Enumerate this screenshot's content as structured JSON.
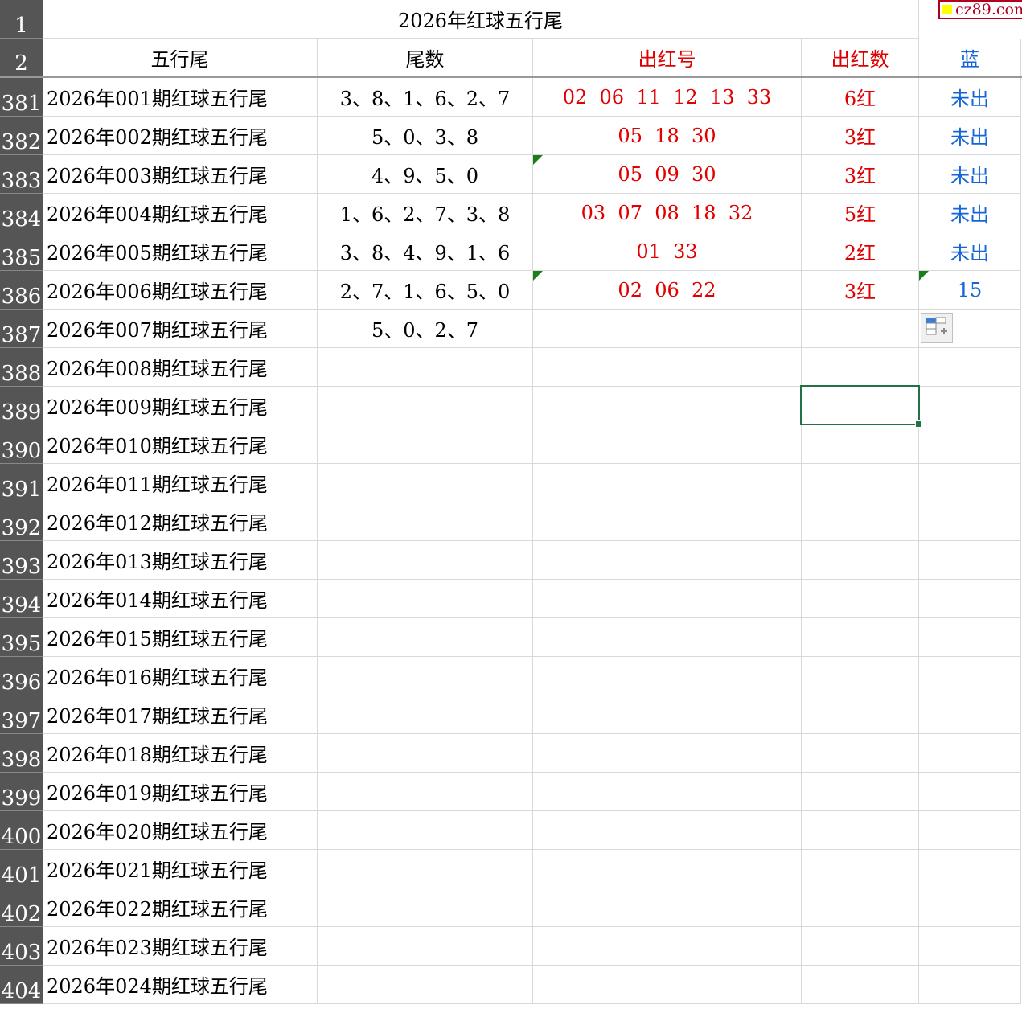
{
  "title": "2026年红球五行尾",
  "watermark": "cz89.com",
  "headers": {
    "row_num": "2",
    "a": "五行尾",
    "b": "尾数",
    "c": "出红号",
    "d": "出红数",
    "e": "蓝"
  },
  "title_row_num": "1",
  "rows": [
    {
      "n": "381",
      "a": "2026年001期红球五行尾",
      "b": "3、8、1、6、2、7",
      "c": "02  06  11  12  13  33",
      "d": "6红",
      "e": "未出"
    },
    {
      "n": "382",
      "a": "2026年002期红球五行尾",
      "b": "5、0、3、8",
      "c": "05  18  30",
      "d": "3红",
      "e": "未出"
    },
    {
      "n": "383",
      "a": "2026年003期红球五行尾",
      "b": "4、9、5、0",
      "c": "05  09  30",
      "d": "3红",
      "e": "未出"
    },
    {
      "n": "384",
      "a": "2026年004期红球五行尾",
      "b": "1、6、2、7、3、8",
      "c": "03  07  08  18  32",
      "d": "5红",
      "e": "未出"
    },
    {
      "n": "385",
      "a": "2026年005期红球五行尾",
      "b": "3、8、4、9、1、6",
      "c": "01  33",
      "d": "2红",
      "e": "未出"
    },
    {
      "n": "386",
      "a": "2026年006期红球五行尾",
      "b": "2、7、1、6、5、0",
      "c": "02  06  22",
      "d": "3红",
      "e": "15"
    },
    {
      "n": "387",
      "a": "2026年007期红球五行尾",
      "b": "5、0、2、7",
      "c": "",
      "d": "",
      "e": ""
    },
    {
      "n": "388",
      "a": "2026年008期红球五行尾",
      "b": "",
      "c": "",
      "d": "",
      "e": ""
    },
    {
      "n": "389",
      "a": "2026年009期红球五行尾",
      "b": "",
      "c": "",
      "d": "",
      "e": ""
    },
    {
      "n": "390",
      "a": "2026年010期红球五行尾",
      "b": "",
      "c": "",
      "d": "",
      "e": ""
    },
    {
      "n": "391",
      "a": "2026年011期红球五行尾",
      "b": "",
      "c": "",
      "d": "",
      "e": ""
    },
    {
      "n": "392",
      "a": "2026年012期红球五行尾",
      "b": "",
      "c": "",
      "d": "",
      "e": ""
    },
    {
      "n": "393",
      "a": "2026年013期红球五行尾",
      "b": "",
      "c": "",
      "d": "",
      "e": ""
    },
    {
      "n": "394",
      "a": "2026年014期红球五行尾",
      "b": "",
      "c": "",
      "d": "",
      "e": ""
    },
    {
      "n": "395",
      "a": "2026年015期红球五行尾",
      "b": "",
      "c": "",
      "d": "",
      "e": ""
    },
    {
      "n": "396",
      "a": "2026年016期红球五行尾",
      "b": "",
      "c": "",
      "d": "",
      "e": ""
    },
    {
      "n": "397",
      "a": "2026年017期红球五行尾",
      "b": "",
      "c": "",
      "d": "",
      "e": ""
    },
    {
      "n": "398",
      "a": "2026年018期红球五行尾",
      "b": "",
      "c": "",
      "d": "",
      "e": ""
    },
    {
      "n": "399",
      "a": "2026年019期红球五行尾",
      "b": "",
      "c": "",
      "d": "",
      "e": ""
    },
    {
      "n": "400",
      "a": "2026年020期红球五行尾",
      "b": "",
      "c": "",
      "d": "",
      "e": ""
    },
    {
      "n": "401",
      "a": "2026年021期红球五行尾",
      "b": "",
      "c": "",
      "d": "",
      "e": ""
    },
    {
      "n": "402",
      "a": "2026年022期红球五行尾",
      "b": "",
      "c": "",
      "d": "",
      "e": ""
    },
    {
      "n": "403",
      "a": "2026年023期红球五行尾",
      "b": "",
      "c": "",
      "d": "",
      "e": ""
    },
    {
      "n": "404",
      "a": "2026年024期红球五行尾",
      "b": "",
      "c": "",
      "d": "",
      "e": ""
    }
  ]
}
